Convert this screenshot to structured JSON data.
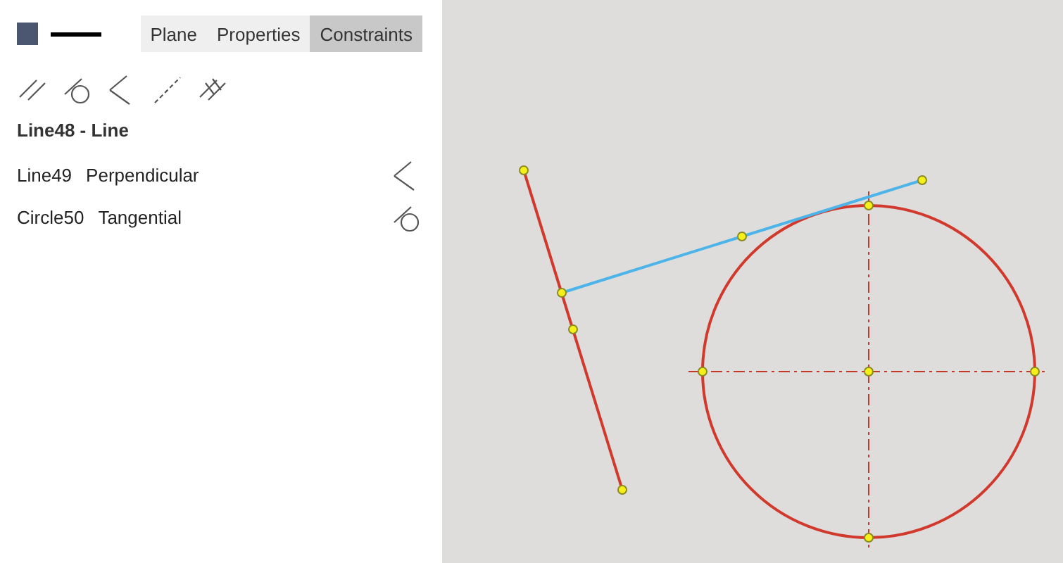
{
  "tabs": [
    {
      "label": "Plane",
      "selected": false
    },
    {
      "label": "Properties",
      "selected": false
    },
    {
      "label": "Constraints",
      "selected": true
    }
  ],
  "selection_title": "Line48 - Line",
  "constraints": [
    {
      "target": "Line49",
      "type": "Perpendicular",
      "kind": "perpendicular"
    },
    {
      "target": "Circle50",
      "type": "Tangential",
      "kind": "tangent"
    }
  ]
}
